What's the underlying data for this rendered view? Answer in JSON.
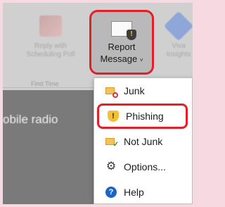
{
  "ribbon": {
    "reply_button_label": "Reply with\nScheduling Poll",
    "group_label": "Find Time",
    "viva_button_label": "Viva\nInsights",
    "report_button": {
      "label_line1": "Report",
      "label_line2": "Message",
      "chevron": "˅",
      "accent_color": "#e1202a"
    }
  },
  "background_text": "obile radio",
  "dropdown": {
    "items": [
      {
        "label": "Junk",
        "icon": "junk-icon"
      },
      {
        "label": "Phishing",
        "icon": "phishing-shield-icon"
      },
      {
        "label": "Not Junk",
        "icon": "not-junk-icon"
      },
      {
        "label": "Options...",
        "icon": "gear-icon"
      },
      {
        "label": "Help",
        "icon": "help-icon"
      }
    ],
    "highlighted_item": "Phishing"
  }
}
